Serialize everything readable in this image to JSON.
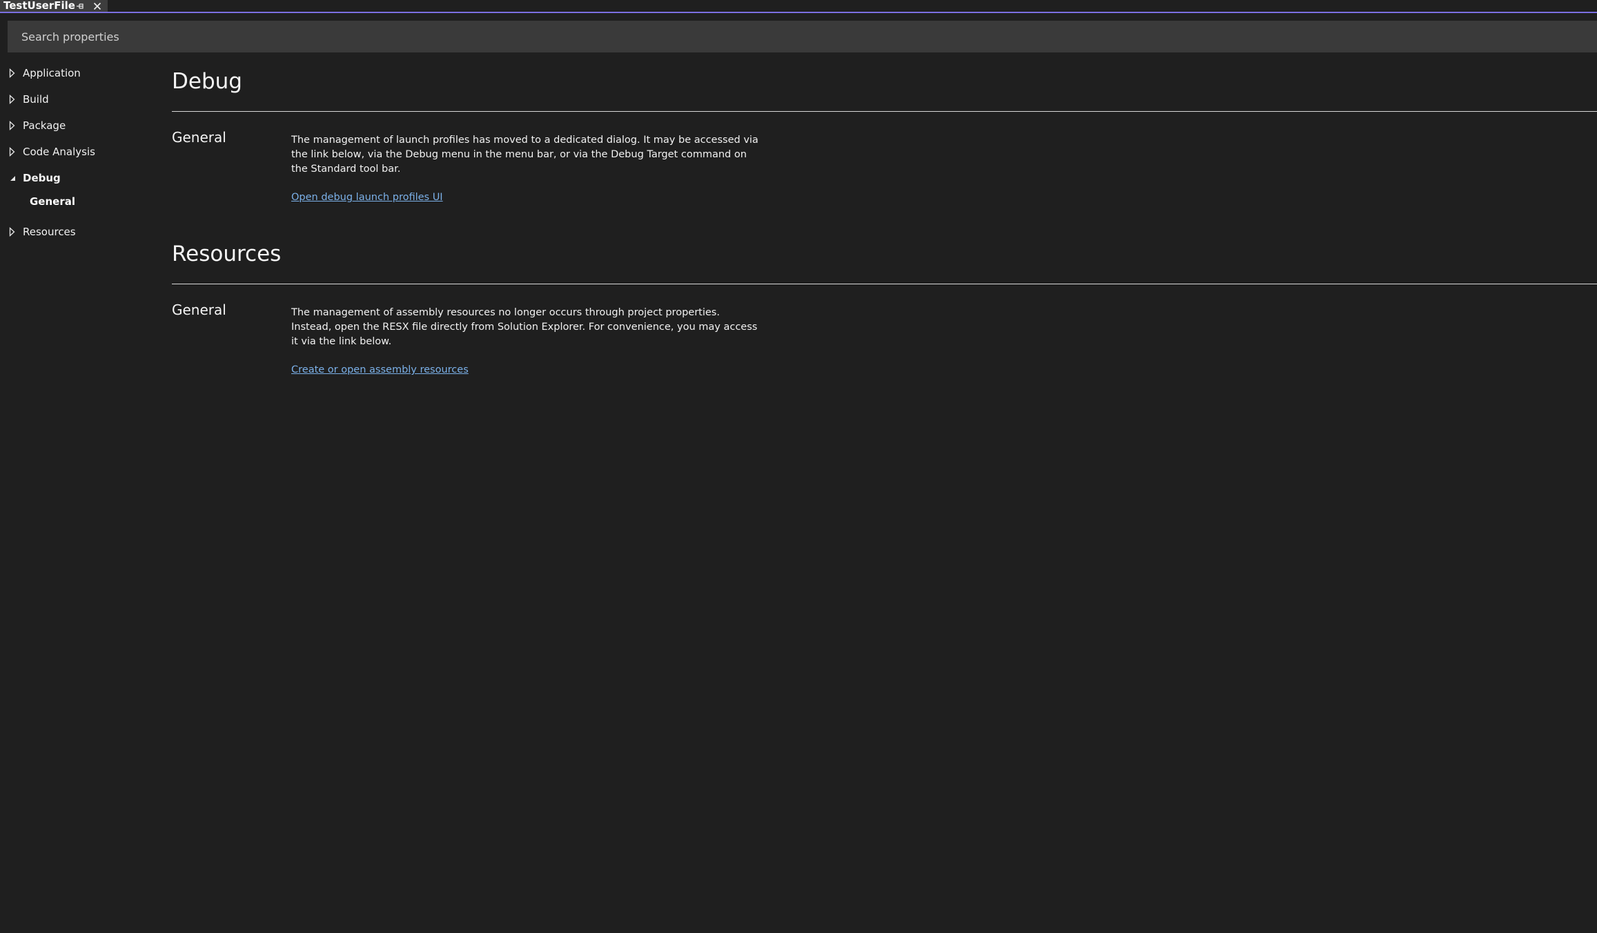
{
  "tab": {
    "title": "TestUserFile"
  },
  "search": {
    "placeholder": "Search properties"
  },
  "nav": {
    "items": [
      {
        "label": "Application",
        "expanded": false
      },
      {
        "label": "Build",
        "expanded": false
      },
      {
        "label": "Package",
        "expanded": false
      },
      {
        "label": "Code Analysis",
        "expanded": false
      },
      {
        "label": "Debug",
        "expanded": true,
        "children": [
          "General"
        ]
      },
      {
        "label": "Resources",
        "expanded": false
      }
    ]
  },
  "sections": [
    {
      "title": "Debug",
      "group": "General",
      "description": "The management of launch profiles has moved to a dedicated dialog. It may be accessed via the link below, via the Debug menu in the menu bar, or via the Debug Target command on the Standard tool bar.",
      "link": "Open debug launch profiles UI"
    },
    {
      "title": "Resources",
      "group": "General",
      "description": "The management of assembly resources no longer occurs through project properties. Instead, open the RESX file directly from Solution Explorer. For convenience, you may access it via the link below.",
      "link": "Create or open assembly resources"
    }
  ],
  "colors": {
    "background": "#1f1f1f",
    "accent": "#7b6fe0",
    "link": "#7bb0e8"
  }
}
